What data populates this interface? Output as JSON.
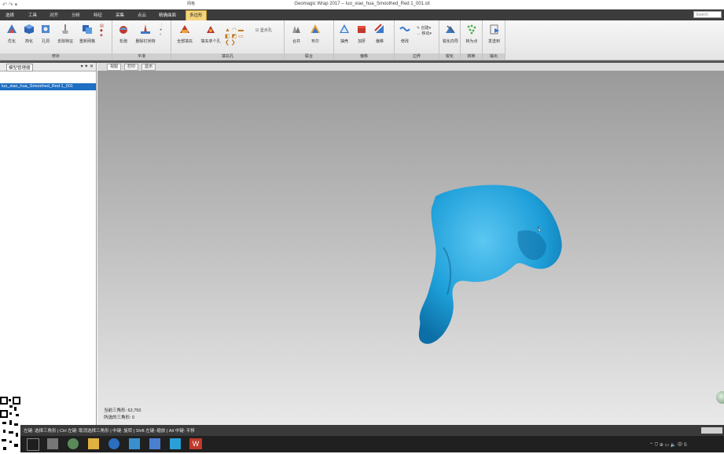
{
  "window": {
    "title": "Geomagic Wrap 2017 -- luo_xiao_hua_Smoothed_Red 1_001.stl",
    "context_tab_group": "网格",
    "quick_access": "↶ ↷ ▾"
  },
  "ribbon_tabs": [
    {
      "label": "选择",
      "active": false
    },
    {
      "label": "工具",
      "active": false
    },
    {
      "label": "对齐",
      "active": false
    },
    {
      "label": "分析",
      "active": false
    },
    {
      "label": "特征",
      "active": false
    },
    {
      "label": "采集",
      "active": false
    },
    {
      "label": "点云",
      "active": false
    },
    {
      "label": "精确曲面",
      "active": false
    },
    {
      "label": "多边形",
      "active": true
    }
  ],
  "search": {
    "placeholder": "Search"
  },
  "ribbon_groups": [
    {
      "label": "修补",
      "buttons": [
        "优化",
        "简化",
        "孔洞",
        "去除特征",
        "重新网格"
      ]
    },
    {
      "label": "平滑",
      "buttons": [
        "松弛",
        "删除钉状物"
      ]
    },
    {
      "label": "填充孔",
      "buttons": [
        "全部填充",
        "填充单个孔"
      ],
      "option": "显示孔"
    },
    {
      "label": "联合",
      "buttons": [
        "合并",
        "布尔"
      ]
    },
    {
      "label": "偏移",
      "buttons": [
        "抽壳",
        "加厚",
        "偏移"
      ]
    },
    {
      "label": "边界",
      "buttons": [
        "修改",
        "创建",
        "移动"
      ]
    },
    {
      "label": "锐化",
      "buttons": [
        "锐化向导"
      ]
    },
    {
      "label": "转换",
      "buttons": [
        "转为点"
      ]
    },
    {
      "label": "输出",
      "buttons": [
        "发送到"
      ]
    }
  ],
  "left_panel": {
    "tab": "模型管理器",
    "pin": "▾ ✦ ✕",
    "selected_item": "luo_xiao_hua_Smoothed_Red 1_001"
  },
  "viewport_tabs": [
    "视图",
    "打印",
    "显示"
  ],
  "viewport_info": {
    "triangles": "当前三角形: 62,750",
    "selected": "所选的三角形: 0"
  },
  "status_bar": "左键: 选择三角形 | Ctrl 左键: 取消选择三角形 | 中键: 旋转 | Shift 左键: 缩放 | Alt 中键: 平移",
  "colors": {
    "model": "#1e9fd9",
    "ribbon_active": "#f5d47a",
    "selection": "#1f6fc2"
  },
  "taskbar_icons": [
    "start-icon",
    "taskview-icon",
    "calculator-icon",
    "app-icon",
    "explorer-icon",
    "browser-icon",
    "app2-icon",
    "app3-icon",
    "app4-icon",
    "wps-icon"
  ]
}
